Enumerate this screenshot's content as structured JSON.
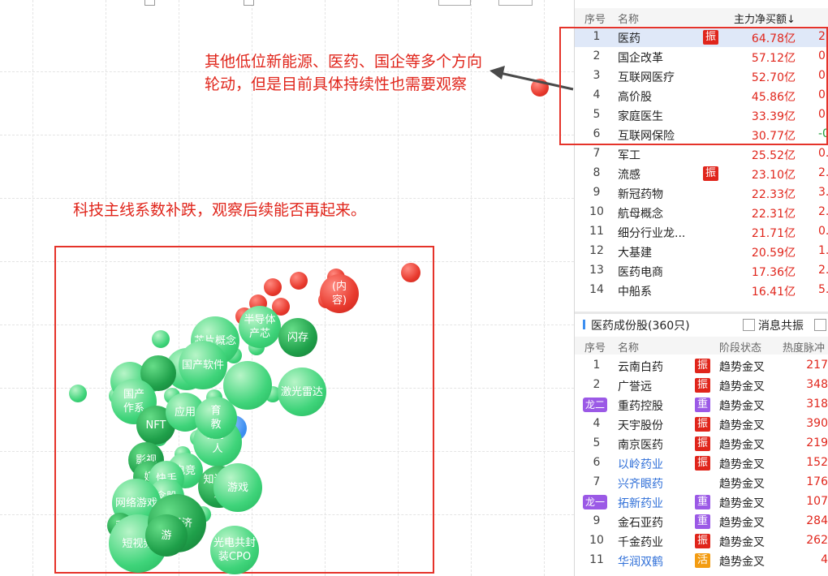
{
  "annotations": {
    "top_note_line1": "其他低位新能源、医药、国企等多个方向",
    "top_note_line2": "轮动，但是目前具体持续性也需要观察",
    "mid_note": "科技主线系数补跌，观察后续能否再起来。"
  },
  "colors": {
    "annotation_red": "#e0251b",
    "box_red": "#e5332a",
    "bubble_green": "#3fd47a",
    "bubble_red": "#e83a2e",
    "bubble_blue": "#3c8ef0",
    "purple_tag": "#9b59e6"
  },
  "bubbles": [
    {
      "label": "芯片概念",
      "tone": "green"
    },
    {
      "label": "半导体\n产芯",
      "tone": "green"
    },
    {
      "label": "闪存",
      "tone": "dark"
    },
    {
      "label": "激光雷达",
      "tone": "green"
    },
    {
      "label": "国产软件",
      "tone": "green"
    },
    {
      "label": "国产\n作系",
      "tone": "green"
    },
    {
      "label": "NFT",
      "tone": "dark"
    },
    {
      "label": "应用",
      "tone": "green"
    },
    {
      "label": "数字\n人",
      "tone": "green"
    },
    {
      "label": "育\n教",
      "tone": "green"
    },
    {
      "label": "影视",
      "tone": "dark"
    },
    {
      "label": "媒",
      "tone": "dark"
    },
    {
      "label": "电竞",
      "tone": "green"
    },
    {
      "label": "快手",
      "tone": "green"
    },
    {
      "label": "念股",
      "tone": "green"
    },
    {
      "label": "知识付\n费",
      "tone": "dark"
    },
    {
      "label": "游戏",
      "tone": "green"
    },
    {
      "label": "网络游戏",
      "tone": "green"
    },
    {
      "label": "手",
      "tone": "dark"
    },
    {
      "label": "短视频",
      "tone": "green"
    },
    {
      "label": "IP经济",
      "tone": "dark"
    },
    {
      "label": "游",
      "tone": "dark"
    },
    {
      "label": "光电共封\n装CPO",
      "tone": "green"
    },
    {
      "label": "(内\n容)",
      "tone": "red"
    }
  ],
  "sector_table": {
    "headers": {
      "no": "序号",
      "name": "名称",
      "inflow": "主力净买额↓"
    },
    "rows": [
      {
        "no": "1",
        "name": "医药",
        "tag": "振",
        "value": "64.78亿",
        "rate": "2.",
        "selected": true
      },
      {
        "no": "2",
        "name": "国企改革",
        "tag": "",
        "value": "57.12亿",
        "rate": "0."
      },
      {
        "no": "3",
        "name": "互联网医疗",
        "tag": "",
        "value": "52.70亿",
        "rate": "0."
      },
      {
        "no": "4",
        "name": "高价股",
        "tag": "",
        "value": "45.86亿",
        "rate": "0."
      },
      {
        "no": "5",
        "name": "家庭医生",
        "tag": "",
        "value": "33.39亿",
        "rate": "0."
      },
      {
        "no": "6",
        "name": "互联网保险",
        "tag": "",
        "value": "30.77亿",
        "rate": "-0.",
        "rate_green": true
      },
      {
        "no": "7",
        "name": "军工",
        "tag": "",
        "value": "25.52亿",
        "rate": "0."
      },
      {
        "no": "8",
        "name": "流感",
        "tag": "振",
        "value": "23.10亿",
        "rate": "2."
      },
      {
        "no": "9",
        "name": "新冠药物",
        "tag": "",
        "value": "22.33亿",
        "rate": "3."
      },
      {
        "no": "10",
        "name": "航母概念",
        "tag": "",
        "value": "22.31亿",
        "rate": "2."
      },
      {
        "no": "11",
        "name": "细分行业龙...",
        "tag": "",
        "value": "21.71亿",
        "rate": "0."
      },
      {
        "no": "12",
        "name": "大基建",
        "tag": "",
        "value": "20.59亿",
        "rate": "1."
      },
      {
        "no": "13",
        "name": "医药电商",
        "tag": "",
        "value": "17.36亿",
        "rate": "2."
      },
      {
        "no": "14",
        "name": "中船系",
        "tag": "",
        "value": "16.41亿",
        "rate": "5."
      }
    ]
  },
  "stock_panel": {
    "title": "医药成份股(360只)",
    "checkbox_label": "消息共振",
    "headers": {
      "no": "序号",
      "name": "名称",
      "stage": "阶段状态",
      "heat": "热度脉冲"
    },
    "rows": [
      {
        "no": "1",
        "pill": "",
        "name": "云南白药",
        "link": false,
        "tag": "振",
        "tagtone": "red",
        "stage": "趋势金叉",
        "heat": "217"
      },
      {
        "no": "2",
        "pill": "",
        "name": "广誉远",
        "link": false,
        "tag": "振",
        "tagtone": "red",
        "stage": "趋势金叉",
        "heat": "348"
      },
      {
        "no": "",
        "pill": "龙二",
        "name": "重药控股",
        "link": false,
        "tag": "重",
        "tagtone": "purple",
        "stage": "趋势金叉",
        "heat": "318"
      },
      {
        "no": "4",
        "pill": "",
        "name": "天宇股份",
        "link": false,
        "tag": "振",
        "tagtone": "red",
        "stage": "趋势金叉",
        "heat": "390"
      },
      {
        "no": "5",
        "pill": "",
        "name": "南京医药",
        "link": false,
        "tag": "振",
        "tagtone": "red",
        "stage": "趋势金叉",
        "heat": "219"
      },
      {
        "no": "6",
        "pill": "",
        "name": "以岭药业",
        "link": true,
        "tag": "振",
        "tagtone": "red",
        "stage": "趋势金叉",
        "heat": "152"
      },
      {
        "no": "7",
        "pill": "",
        "name": "兴齐眼药",
        "link": true,
        "tag": "",
        "tagtone": "",
        "stage": "趋势金叉",
        "heat": "176"
      },
      {
        "no": "",
        "pill": "龙一",
        "name": "拓新药业",
        "link": true,
        "tag": "重",
        "tagtone": "purple",
        "stage": "趋势金叉",
        "heat": "107"
      },
      {
        "no": "9",
        "pill": "",
        "name": "金石亚药",
        "link": false,
        "tag": "重",
        "tagtone": "purple",
        "stage": "趋势金叉",
        "heat": "284"
      },
      {
        "no": "10",
        "pill": "",
        "name": "千金药业",
        "link": false,
        "tag": "振",
        "tagtone": "red",
        "stage": "趋势金叉",
        "heat": "262"
      },
      {
        "no": "11",
        "pill": "",
        "name": "华润双鹤",
        "link": true,
        "tag": "活",
        "tagtone": "orange",
        "stage": "趋势金叉",
        "heat": "4"
      }
    ]
  }
}
